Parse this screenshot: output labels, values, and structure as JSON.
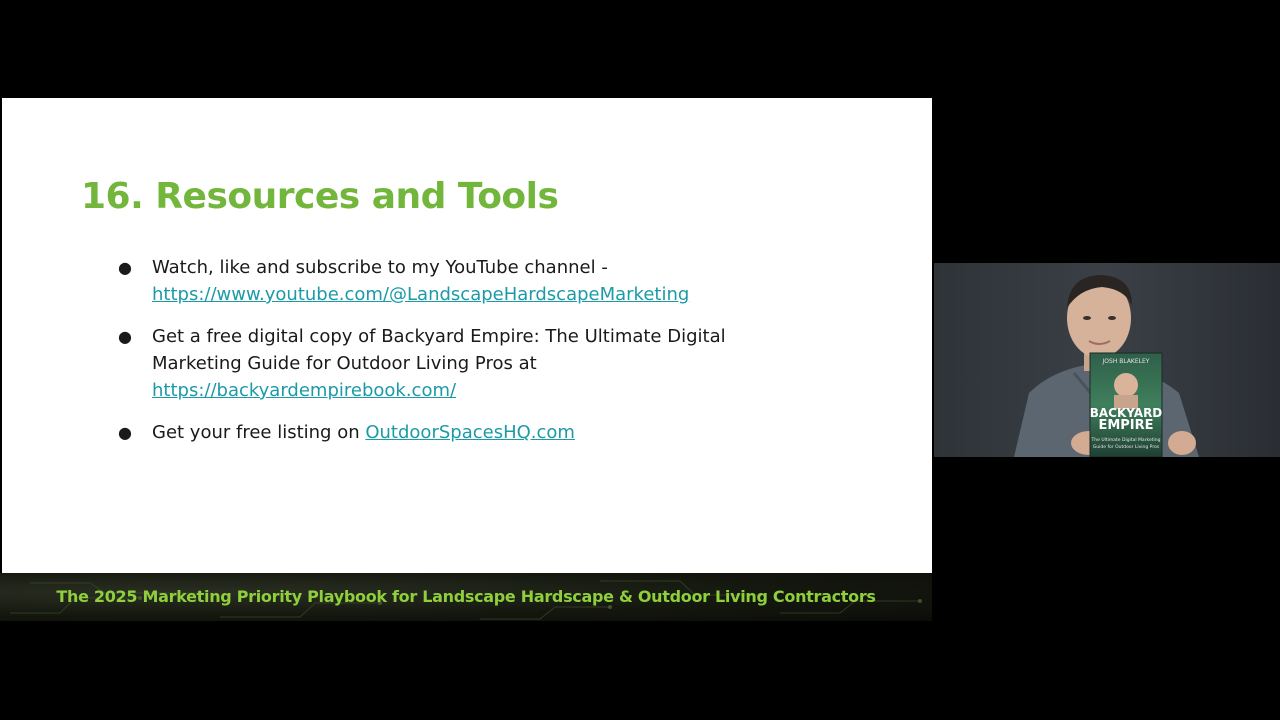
{
  "slide": {
    "title": "16. Resources and Tools",
    "bullets": [
      {
        "text": "Watch, like and subscribe to my YouTube channel - ",
        "link": "https://www.youtube.com/@LandscapeHardscapeMarketing"
      },
      {
        "text": "Get a free digital copy of Backyard Empire: The Ultimate Digital Marketing Guide for Outdoor Living Pros at ",
        "link": "https://backyardempirebook.com/"
      },
      {
        "text": "Get your free listing on ",
        "link": "OutdoorSpacesHQ.com"
      }
    ],
    "bullet_glyph": "●"
  },
  "banner": {
    "text": "The 2025 Marketing Priority Playbook for Landscape Hardscape & Outdoor Living Contractors"
  },
  "webcam": {
    "book_author": "JOSH BLAKELEY",
    "book_title_line1": "BACKYARD",
    "book_title_line2": "EMPIRE",
    "book_subtitle_line1": "The Ultimate Digital Marketing",
    "book_subtitle_line2": "Guide for Outdoor Living Pros"
  },
  "colors": {
    "title_green": "#72b63b",
    "link_teal": "#1b9aa8",
    "banner_green": "#8fcf3c"
  }
}
